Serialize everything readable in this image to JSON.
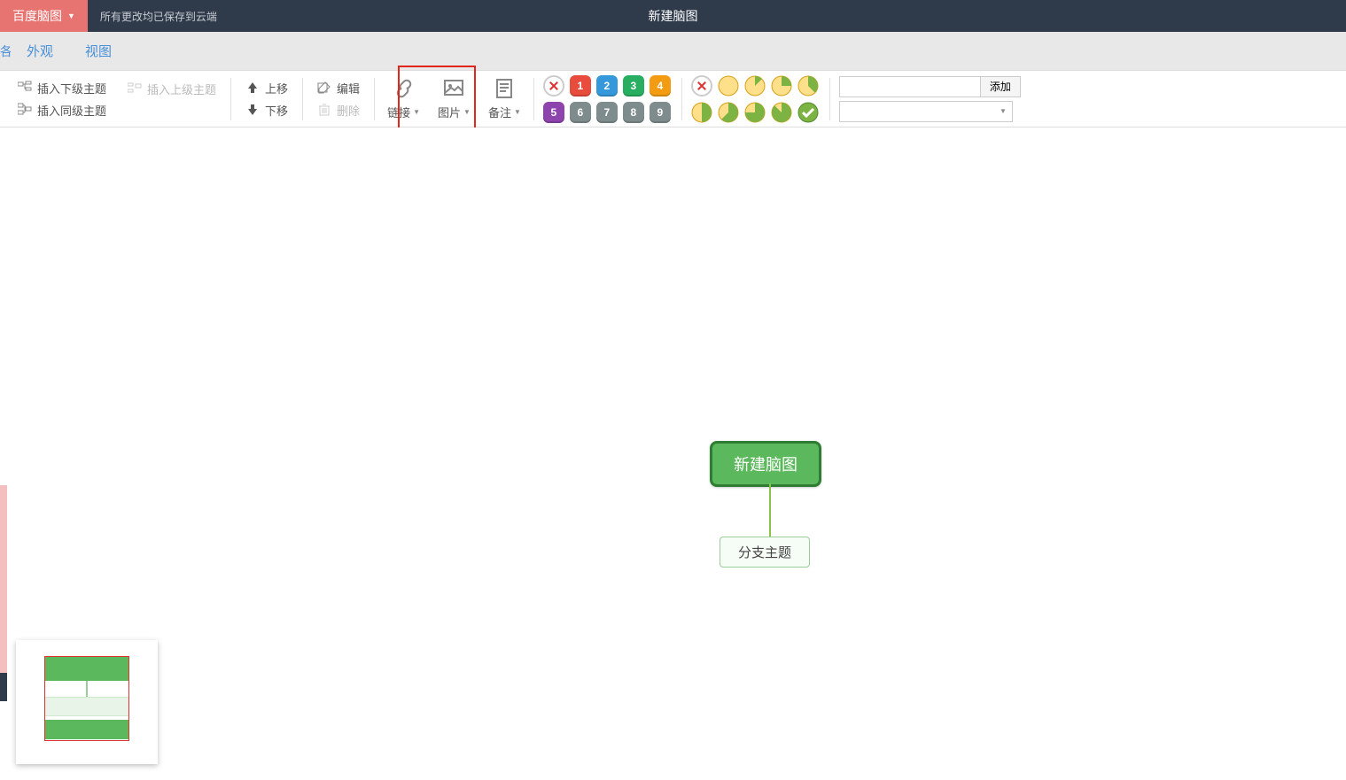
{
  "header": {
    "brand": "百度脑图",
    "save_status": "所有更改均已保存到云端",
    "doc_title": "新建脑图"
  },
  "tabs": {
    "cut": "各",
    "appearance": "外观",
    "view": "视图"
  },
  "toolbar": {
    "insert_child": "插入下级主题",
    "insert_parent": "插入上级主题",
    "insert_sibling": "插入同级主题",
    "move_up": "上移",
    "move_down": "下移",
    "edit": "编辑",
    "delete": "删除",
    "link": "链接",
    "image": "图片",
    "note": "备注",
    "add": "添加"
  },
  "priority": {
    "values": [
      "1",
      "2",
      "3",
      "4",
      "5",
      "6",
      "7",
      "8",
      "9"
    ],
    "colors": [
      "#e74c3c",
      "#3498db",
      "#27ae60",
      "#f39c12",
      "#8e44ad",
      "#7f8c8d",
      "#7f8c8d",
      "#7f8c8d",
      "#7f8c8d"
    ]
  },
  "progress_fracs": [
    0,
    0.125,
    0.25,
    0.375,
    0.5,
    0.625,
    0.75,
    0.875,
    1.0
  ],
  "mindmap": {
    "root": "新建脑图",
    "child": "分支主题"
  }
}
